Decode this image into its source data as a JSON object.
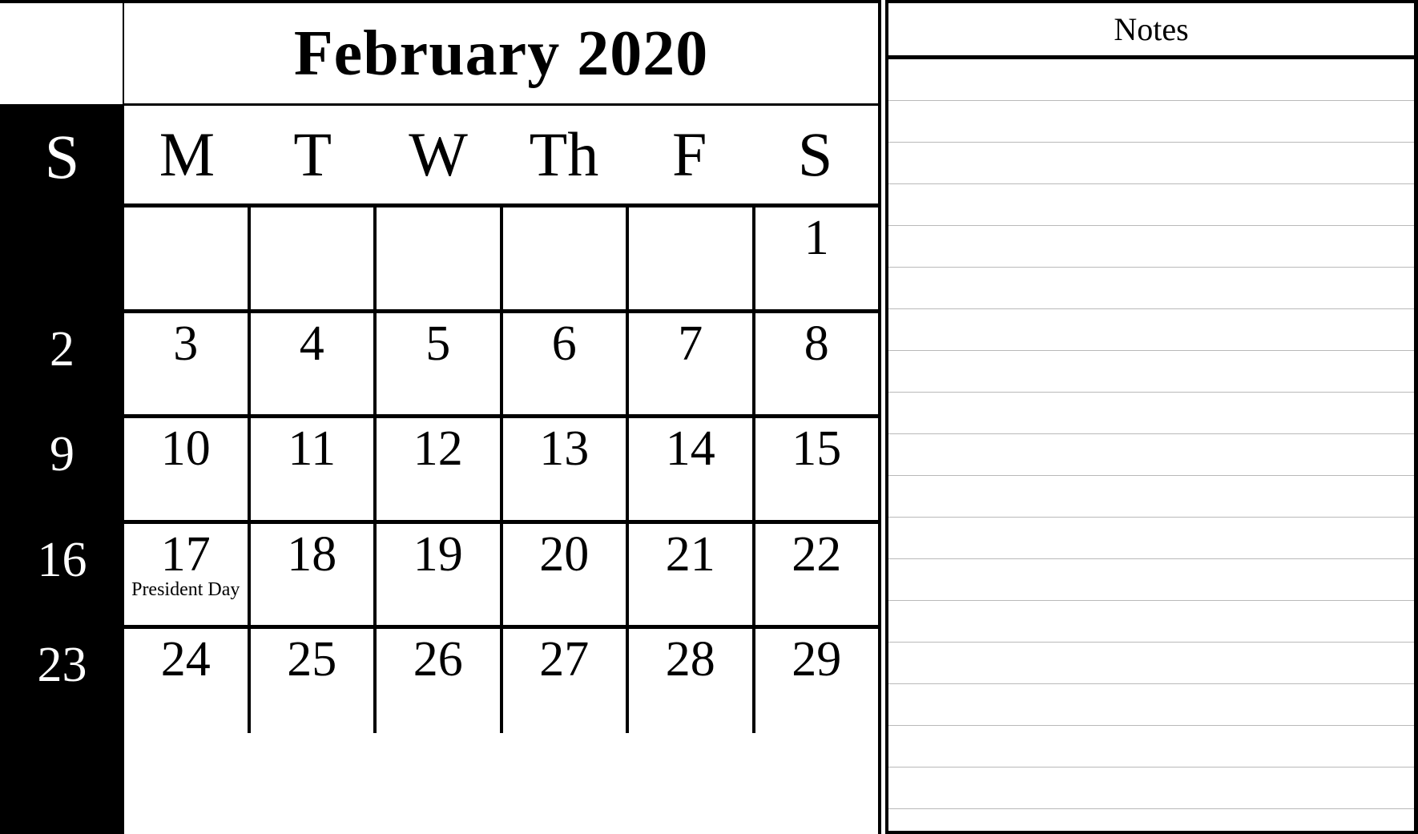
{
  "calendar": {
    "title": "February 2020",
    "month": "February",
    "year": "2020",
    "weekday_headers": [
      "S",
      "M",
      "T",
      "W",
      "Th",
      "F",
      "S"
    ],
    "sunday_header": "S",
    "sunday_dates": [
      "",
      "2",
      "9",
      "16",
      "23"
    ],
    "weeks": [
      [
        {
          "num": "",
          "event": ""
        },
        {
          "num": "",
          "event": ""
        },
        {
          "num": "",
          "event": ""
        },
        {
          "num": "",
          "event": ""
        },
        {
          "num": "",
          "event": ""
        },
        {
          "num": "1",
          "event": ""
        }
      ],
      [
        {
          "num": "3",
          "event": ""
        },
        {
          "num": "4",
          "event": ""
        },
        {
          "num": "5",
          "event": ""
        },
        {
          "num": "6",
          "event": ""
        },
        {
          "num": "7",
          "event": ""
        },
        {
          "num": "8",
          "event": ""
        }
      ],
      [
        {
          "num": "10",
          "event": ""
        },
        {
          "num": "11",
          "event": ""
        },
        {
          "num": "12",
          "event": ""
        },
        {
          "num": "13",
          "event": ""
        },
        {
          "num": "14",
          "event": ""
        },
        {
          "num": "15",
          "event": ""
        }
      ],
      [
        {
          "num": "17",
          "event": "President Day"
        },
        {
          "num": "18",
          "event": ""
        },
        {
          "num": "19",
          "event": ""
        },
        {
          "num": "20",
          "event": ""
        },
        {
          "num": "21",
          "event": ""
        },
        {
          "num": "22",
          "event": ""
        }
      ],
      [
        {
          "num": "24",
          "event": ""
        },
        {
          "num": "25",
          "event": ""
        },
        {
          "num": "26",
          "event": ""
        },
        {
          "num": "27",
          "event": ""
        },
        {
          "num": "28",
          "event": ""
        },
        {
          "num": "29",
          "event": ""
        }
      ]
    ]
  },
  "notes": {
    "title": "Notes",
    "line_count": 18,
    "lines": [
      "",
      "",
      "",
      "",
      "",
      "",
      "",
      "",
      "",
      "",
      "",
      "",
      "",
      "",
      "",
      "",
      "",
      ""
    ]
  },
  "colors": {
    "ink": "#000000",
    "paper": "#ffffff",
    "sunday_background": "#000000",
    "sunday_text": "#ffffff",
    "note_rule": "#b9b9b9"
  }
}
